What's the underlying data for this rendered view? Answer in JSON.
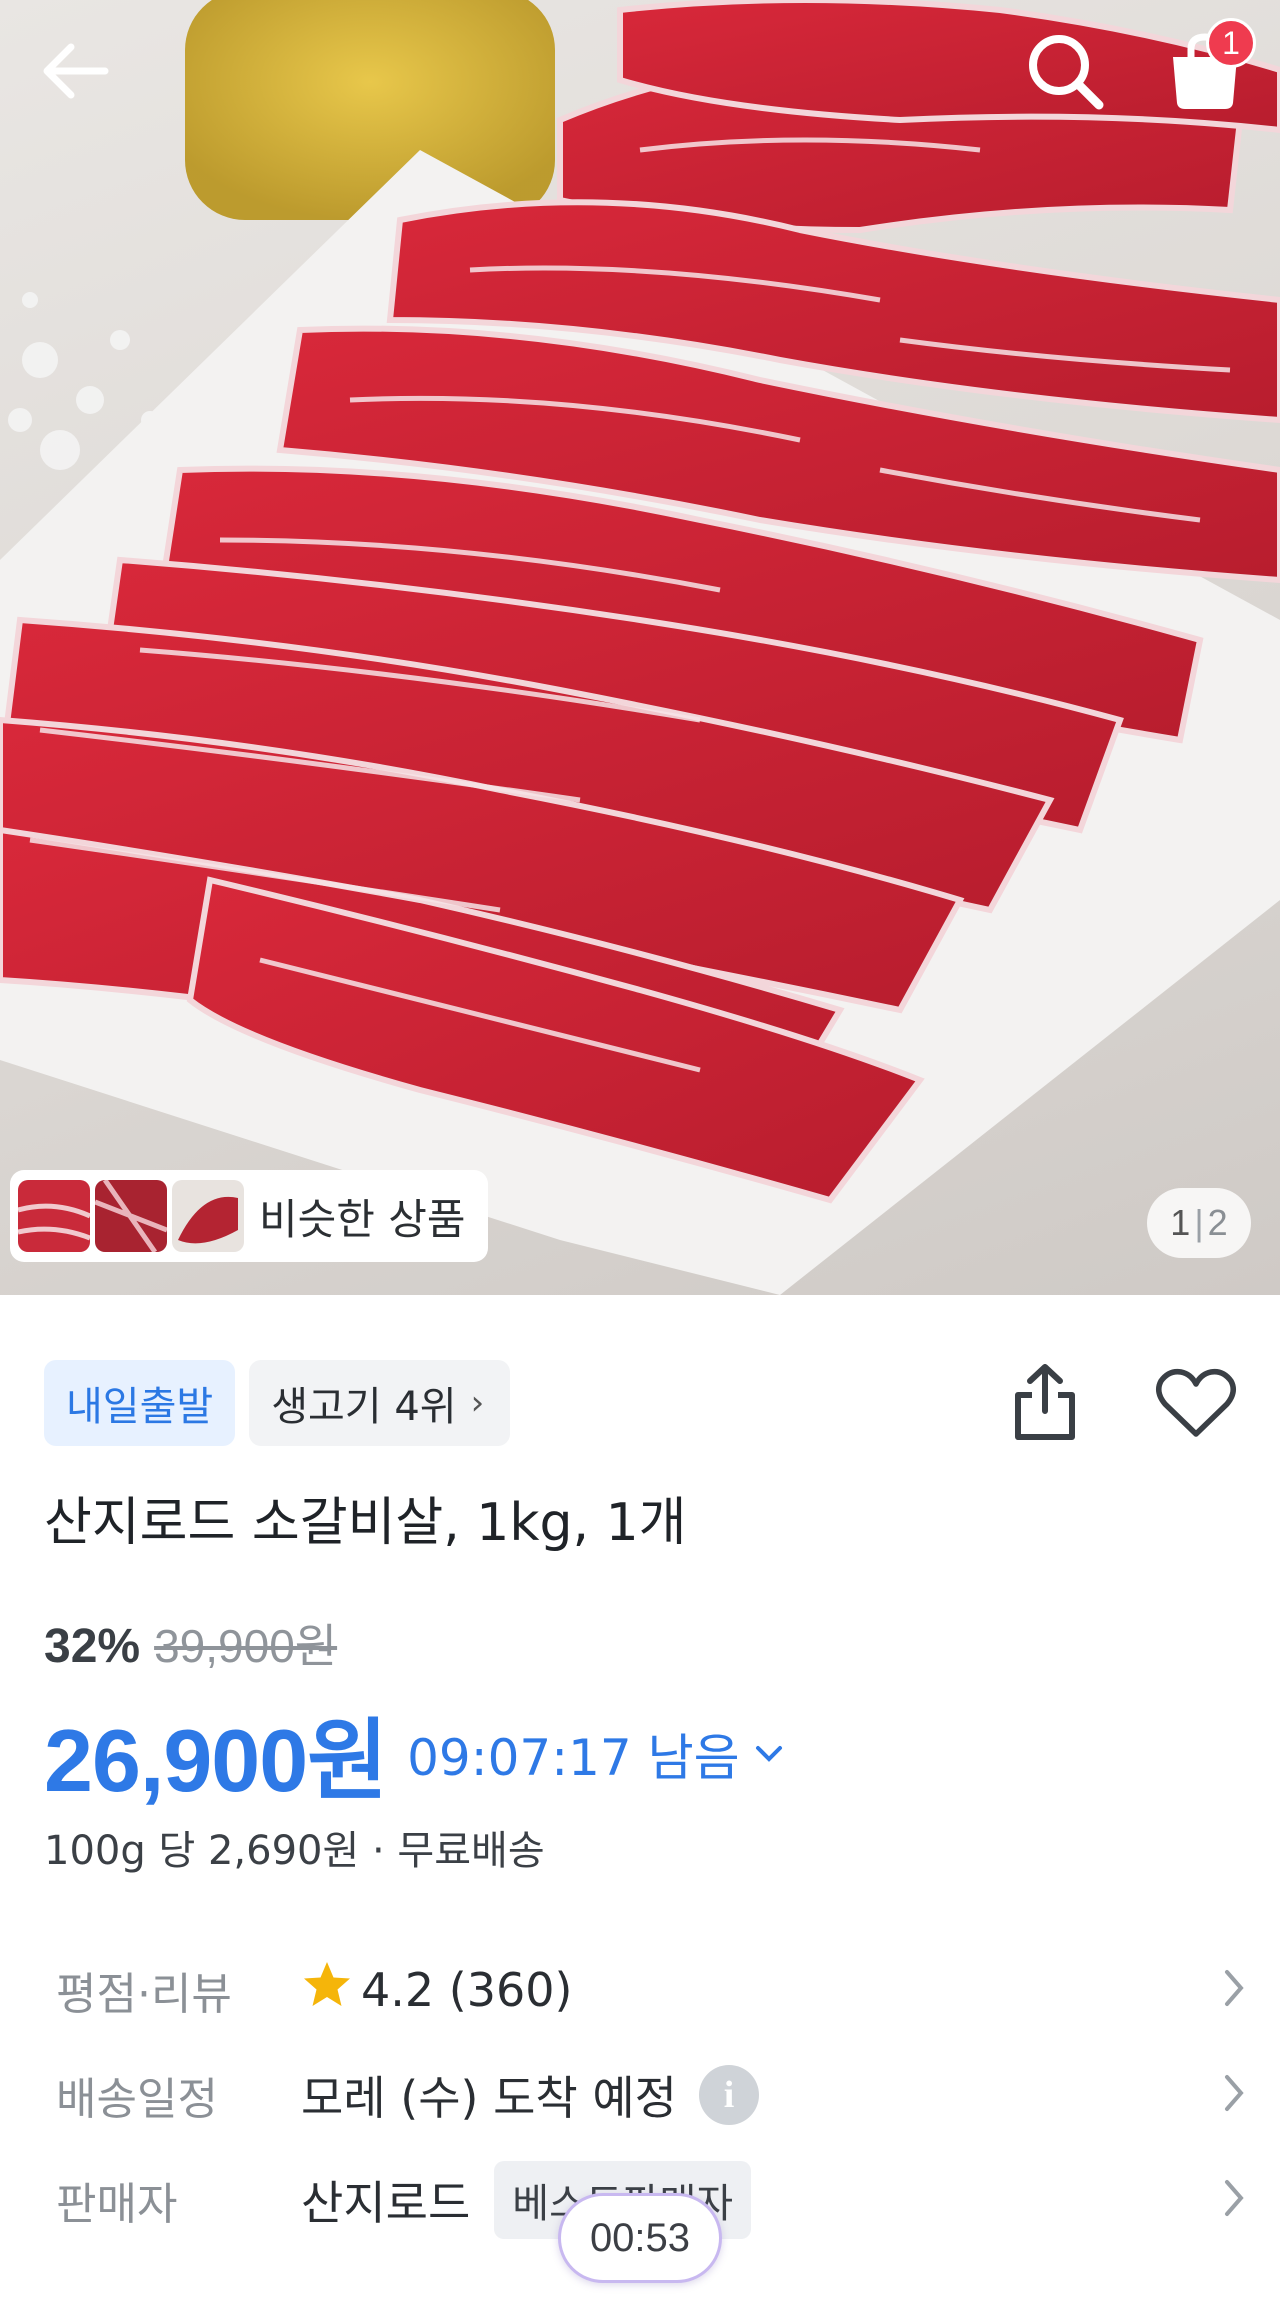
{
  "header": {
    "back_icon": "arrow-left-icon",
    "search_icon": "search-icon",
    "cart_icon": "shopping-bag-icon",
    "cart_count": "1"
  },
  "gallery": {
    "similar_label": "비슷한 상품",
    "page_current": "1",
    "page_total": "2"
  },
  "product": {
    "badge_delivery": "내일출발",
    "badge_rank": "생고기 4위",
    "title": "산지로드 소갈비살, 1kg, 1개",
    "discount": "32%",
    "original_price": "39,900원",
    "price": "26,900원",
    "timer": "09:07:17 남음",
    "unit_info": "100g 당 2,690원 · 무료배송"
  },
  "details": {
    "rating_key": "평점·리뷰",
    "rating_value": "4.2 (360)",
    "shipping_key": "배송일정",
    "shipping_value": "모레 (수) 도착 예정",
    "seller_key": "판매자",
    "seller_value": "산지로드",
    "seller_tag": "베스트판매자"
  },
  "overlay": {
    "timer_pill": "00:53"
  },
  "colors": {
    "accent": "#2e79e6",
    "badge_bg": "#e7f1ff",
    "cart_badge": "#ef3b4f",
    "star": "#f5b50a"
  }
}
